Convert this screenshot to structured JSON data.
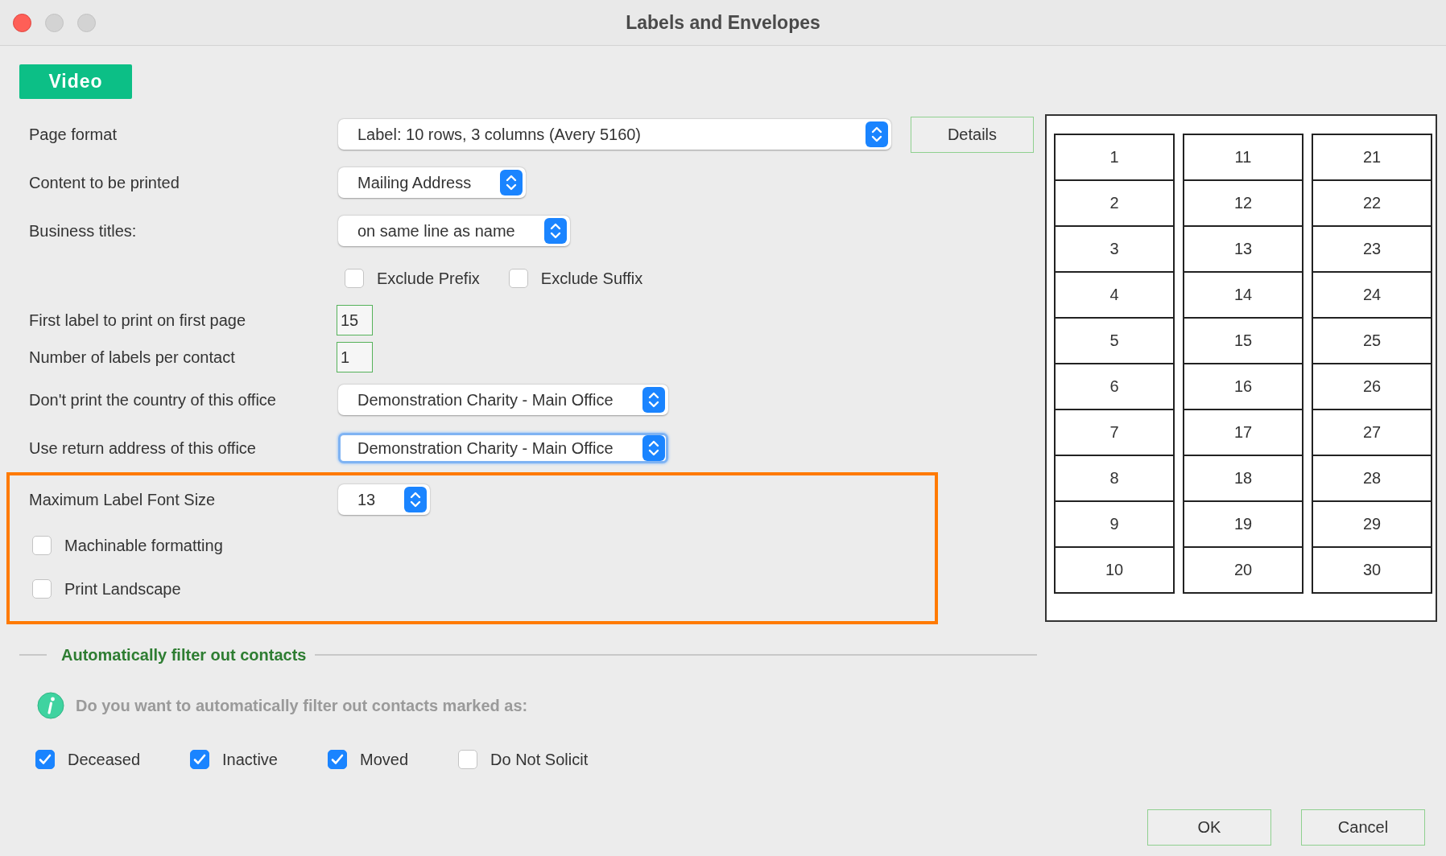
{
  "window": {
    "title": "Labels and Envelopes"
  },
  "video_button": "Video",
  "form": [
    {
      "kind": "select",
      "label": "Page format",
      "value": "Label: 10 rows, 3 columns (Avery 5160)",
      "focused": false,
      "side_button": "Details"
    },
    {
      "kind": "select",
      "label": "Content to be printed",
      "value": "Mailing Address",
      "focused": false
    },
    {
      "kind": "select",
      "label": "Business titles:",
      "value": "on same line as name",
      "focused": false
    },
    {
      "kind": "checks",
      "options": [
        {
          "label": "Exclude Prefix",
          "checked": false
        },
        {
          "label": "Exclude Suffix",
          "checked": false
        }
      ]
    },
    {
      "kind": "number",
      "label": "First label to print on first page",
      "value": "15"
    },
    {
      "kind": "number",
      "label": "Number of labels per contact",
      "value": "1"
    },
    {
      "kind": "select",
      "label": "Don't print the country of this office",
      "value": "Demonstration Charity - Main Office",
      "focused": false
    },
    {
      "kind": "select",
      "label": "Use return address of this office",
      "value": "Demonstration Charity - Main Office",
      "focused": true
    }
  ],
  "highlighted_options": [
    {
      "kind": "select",
      "label": "Maximum Label Font Size",
      "value": "13",
      "focused": false
    },
    {
      "kind": "check",
      "label": "Machinable formatting",
      "checked": false
    },
    {
      "kind": "check",
      "label": "Print Landscape",
      "checked": false
    }
  ],
  "label_preview": {
    "columns": [
      [
        "1",
        "2",
        "3",
        "4",
        "5",
        "6",
        "7",
        "8",
        "9",
        "10"
      ],
      [
        "11",
        "12",
        "13",
        "14",
        "15",
        "16",
        "17",
        "18",
        "19",
        "20"
      ],
      [
        "21",
        "22",
        "23",
        "24",
        "25",
        "26",
        "27",
        "28",
        "29",
        "30"
      ]
    ]
  },
  "filter_section": {
    "title": "Automatically filter out contacts",
    "info": "Do you want to automatically filter out contacts marked as:",
    "options": [
      {
        "label": "Deceased",
        "checked": true
      },
      {
        "label": "Inactive",
        "checked": true
      },
      {
        "label": "Moved",
        "checked": true
      },
      {
        "label": "Do Not Solicit",
        "checked": false
      }
    ]
  },
  "buttons": [
    "OK",
    "Cancel"
  ]
}
